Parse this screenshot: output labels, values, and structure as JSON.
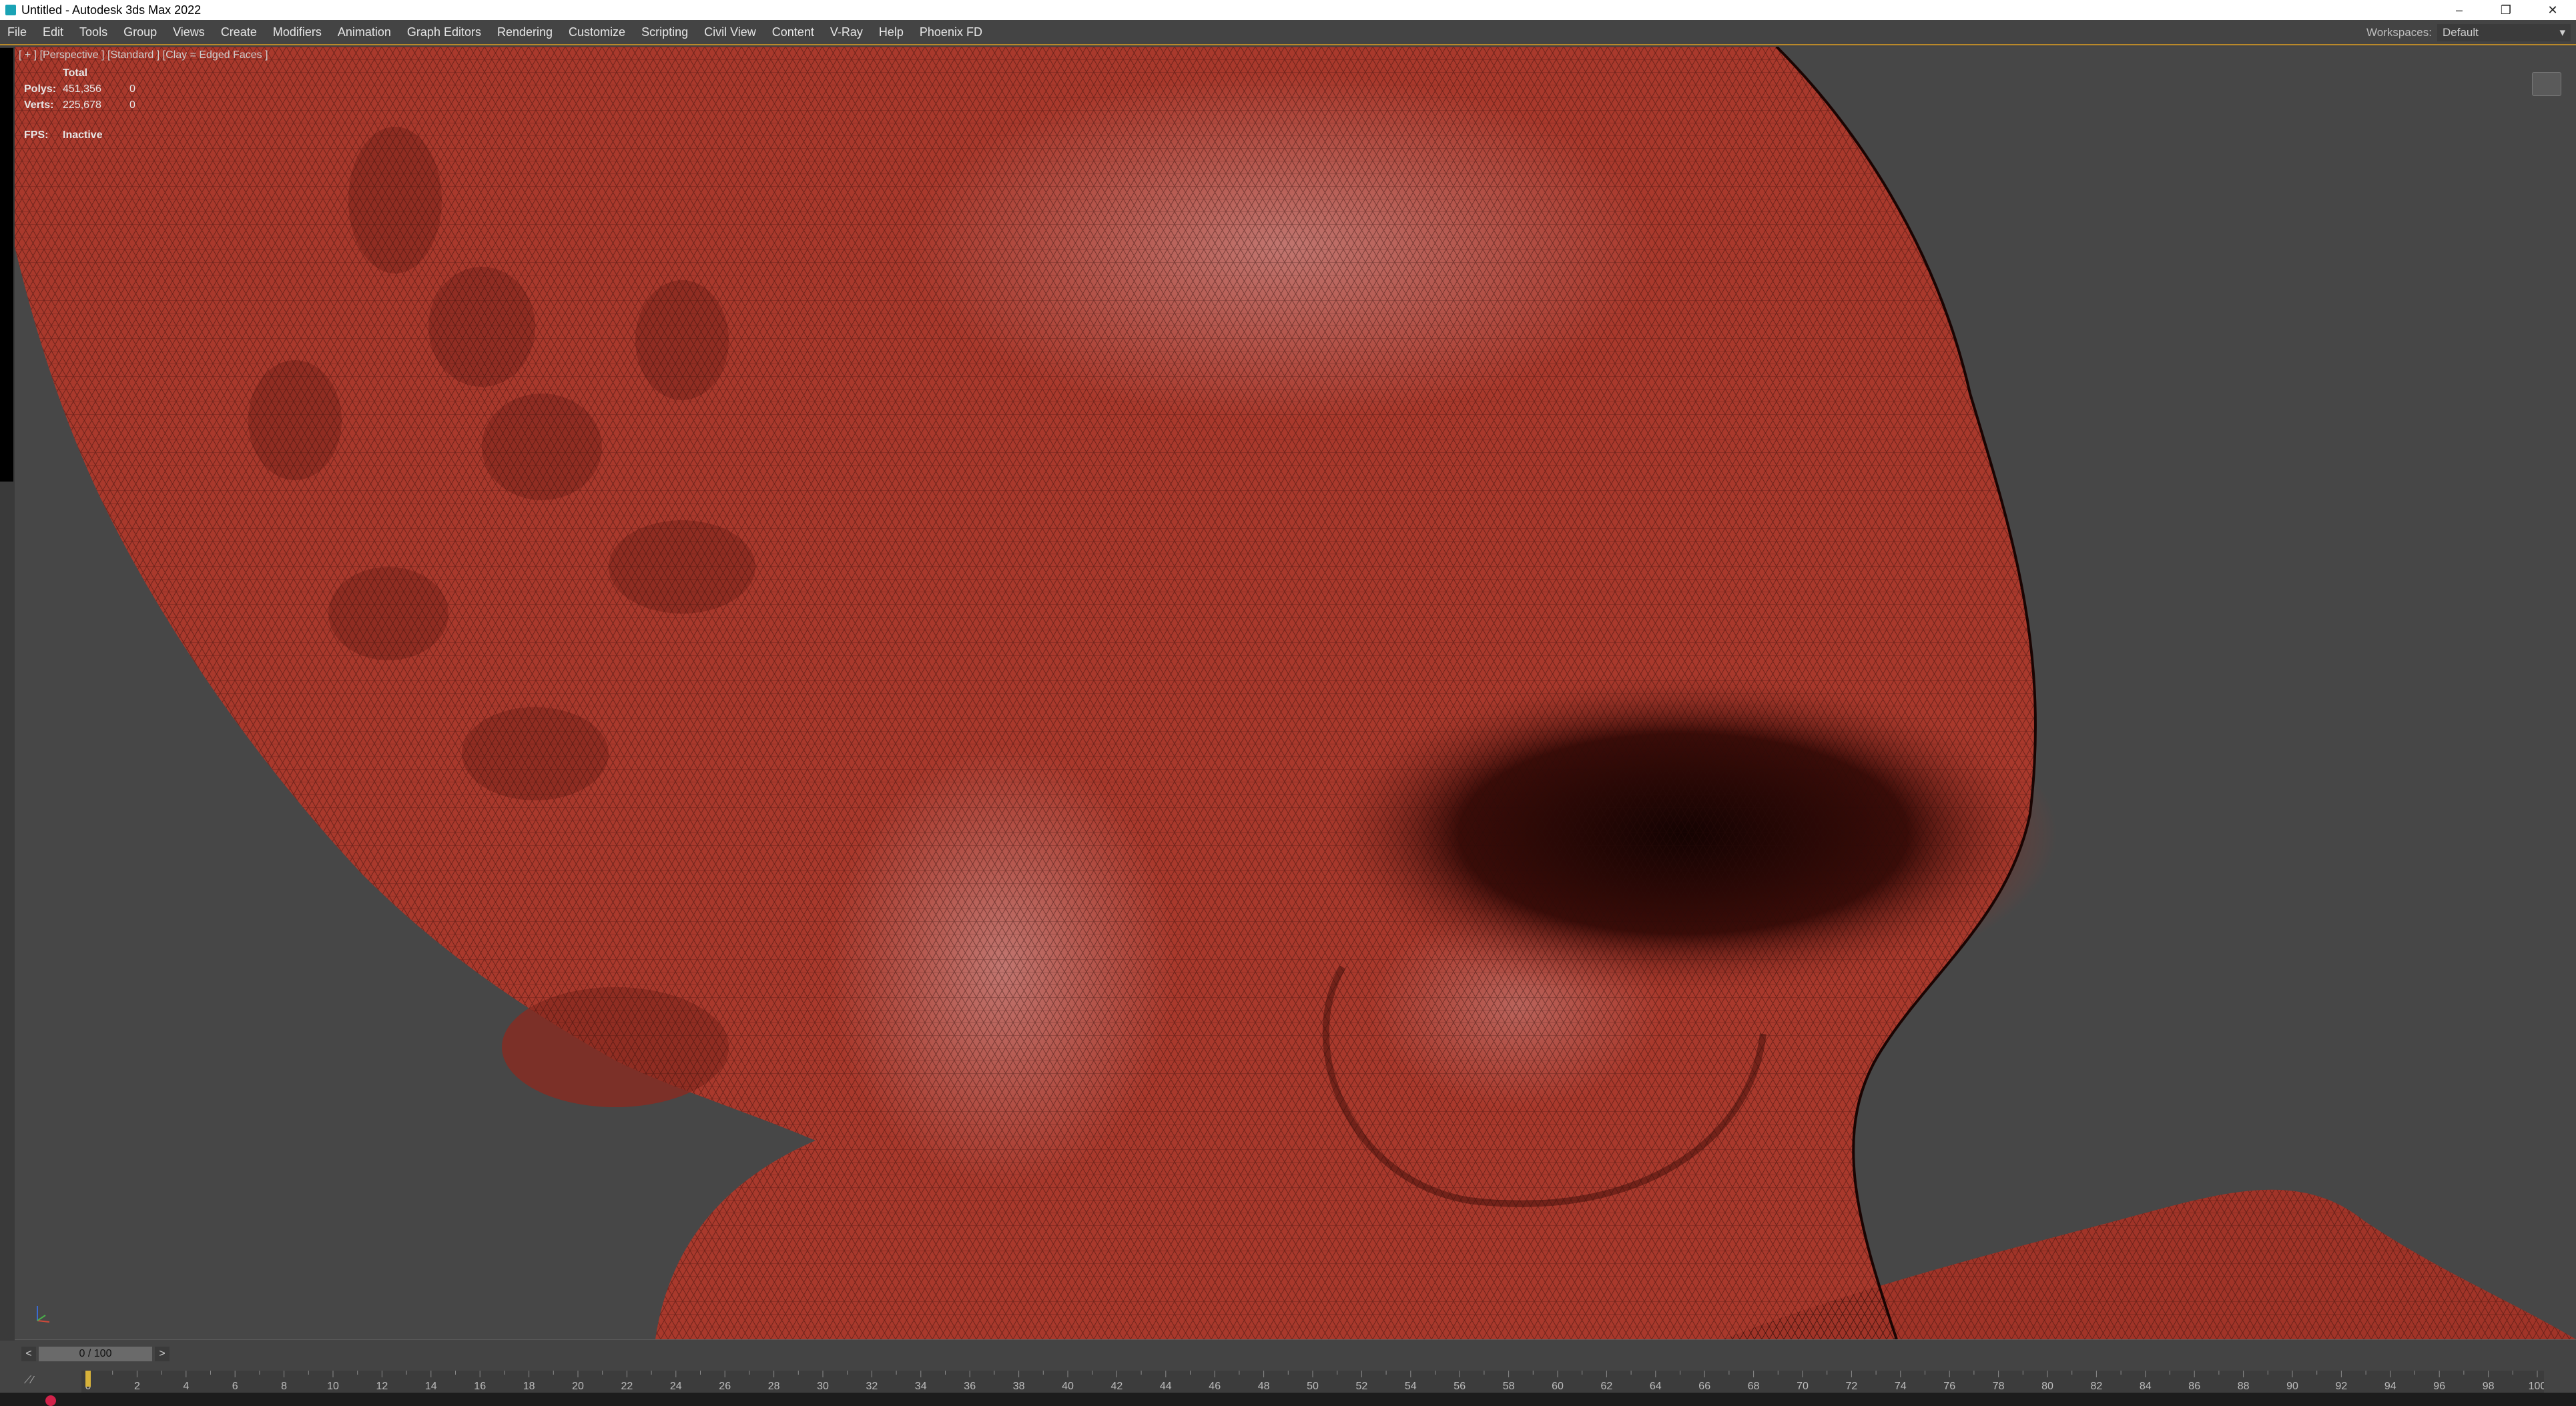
{
  "window": {
    "title": "Untitled - Autodesk 3ds Max 2022",
    "controls": {
      "minimize": "–",
      "restore": "❐",
      "close": "✕"
    }
  },
  "menubar": {
    "items": [
      "File",
      "Edit",
      "Tools",
      "Group",
      "Views",
      "Create",
      "Modifiers",
      "Animation",
      "Graph Editors",
      "Rendering",
      "Customize",
      "Scripting",
      "Civil View",
      "Content",
      "V-Ray",
      "Help",
      "Phoenix FD"
    ],
    "workspaces_label": "Workspaces:",
    "workspace_value": "Default",
    "accent_color": "#b9892a"
  },
  "viewport": {
    "label": "[ + ] [Perspective ] [Standard ] [Clay = Edged Faces ]",
    "stats": {
      "header": "Total",
      "rows": [
        {
          "key": "Polys:",
          "value": "451,356",
          "selected": "0"
        },
        {
          "key": "Verts:",
          "value": "225,678",
          "selected": "0"
        }
      ],
      "fps_label": "FPS:",
      "fps_value": "Inactive"
    },
    "mesh_color": "#a9392c",
    "background_color": "#474747"
  },
  "timeline": {
    "prev": "<",
    "next": ">",
    "frame_display": "0 / 100",
    "current_frame": 0,
    "ticks": [
      "0",
      "2",
      "4",
      "6",
      "8",
      "10",
      "12",
      "14",
      "16",
      "18",
      "20",
      "22",
      "24",
      "26",
      "28",
      "30",
      "32",
      "34",
      "36",
      "38",
      "40",
      "42",
      "44",
      "46",
      "48",
      "50",
      "52",
      "54",
      "56",
      "58",
      "60",
      "62",
      "64",
      "66",
      "68",
      "70",
      "72",
      "74",
      "76",
      "78",
      "80",
      "82",
      "84",
      "86",
      "88",
      "90",
      "92",
      "94",
      "96",
      "98",
      "100"
    ]
  }
}
